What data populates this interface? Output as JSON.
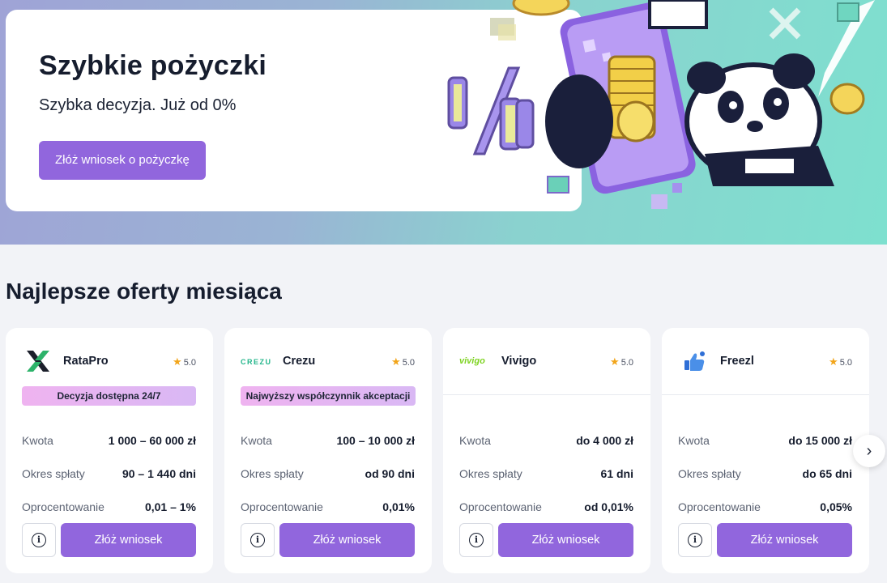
{
  "hero": {
    "title": "Szybkie pożyczki",
    "subtitle": "Szybka decyzja. Już od 0%",
    "cta": "Złóż wniosek o pożyczkę"
  },
  "section": {
    "title": "Najlepsze oferty miesiąca"
  },
  "cards": [
    {
      "brand": "RataPro",
      "rating": "5.0",
      "badge": "Decyzja dostępna 24/7",
      "amount_label": "Kwota",
      "amount": "1 000 – 60 000 zł",
      "period_label": "Okres spłaty",
      "period": "90 – 1 440 dni",
      "rate_label": "Oprocentowanie",
      "rate": "0,01 – 1%",
      "apply": "Złóż wniosek",
      "logo_icon": "ratapro-logo-icon"
    },
    {
      "brand": "Crezu",
      "logo_text": "CREZU",
      "rating": "5.0",
      "badge": "Najwyższy współczynnik akceptacji",
      "amount_label": "Kwota",
      "amount": "100 – 10 000 zł",
      "period_label": "Okres spłaty",
      "period": "od 90 dni",
      "rate_label": "Oprocentowanie",
      "rate": "0,01%",
      "apply": "Złóż wniosek",
      "logo_icon": "crezu-logo-icon"
    },
    {
      "brand": "Vivigo",
      "logo_text": "vivigo",
      "rating": "5.0",
      "amount_label": "Kwota",
      "amount": "do 4 000 zł",
      "period_label": "Okres spłaty",
      "period": "61 dni",
      "rate_label": "Oprocentowanie",
      "rate": "od 0,01%",
      "apply": "Złóż wniosek",
      "logo_icon": "vivigo-logo-icon"
    },
    {
      "brand": "Freezl",
      "rating": "5.0",
      "amount_label": "Kwota",
      "amount": "do 15 000 zł",
      "period_label": "Okres spłaty",
      "period": "do 65 dni",
      "rate_label": "Oprocentowanie",
      "rate": "0,05%",
      "apply": "Złóż wniosek",
      "logo_icon": "freezl-logo-icon"
    }
  ],
  "icons": {
    "info": "info-icon",
    "star": "star-icon",
    "next": "chevron-right-icon"
  },
  "colors": {
    "accent": "#9166dd",
    "badge_start": "#efb3f0",
    "badge_end": "#d9b8f4",
    "star": "#f2a51a"
  }
}
